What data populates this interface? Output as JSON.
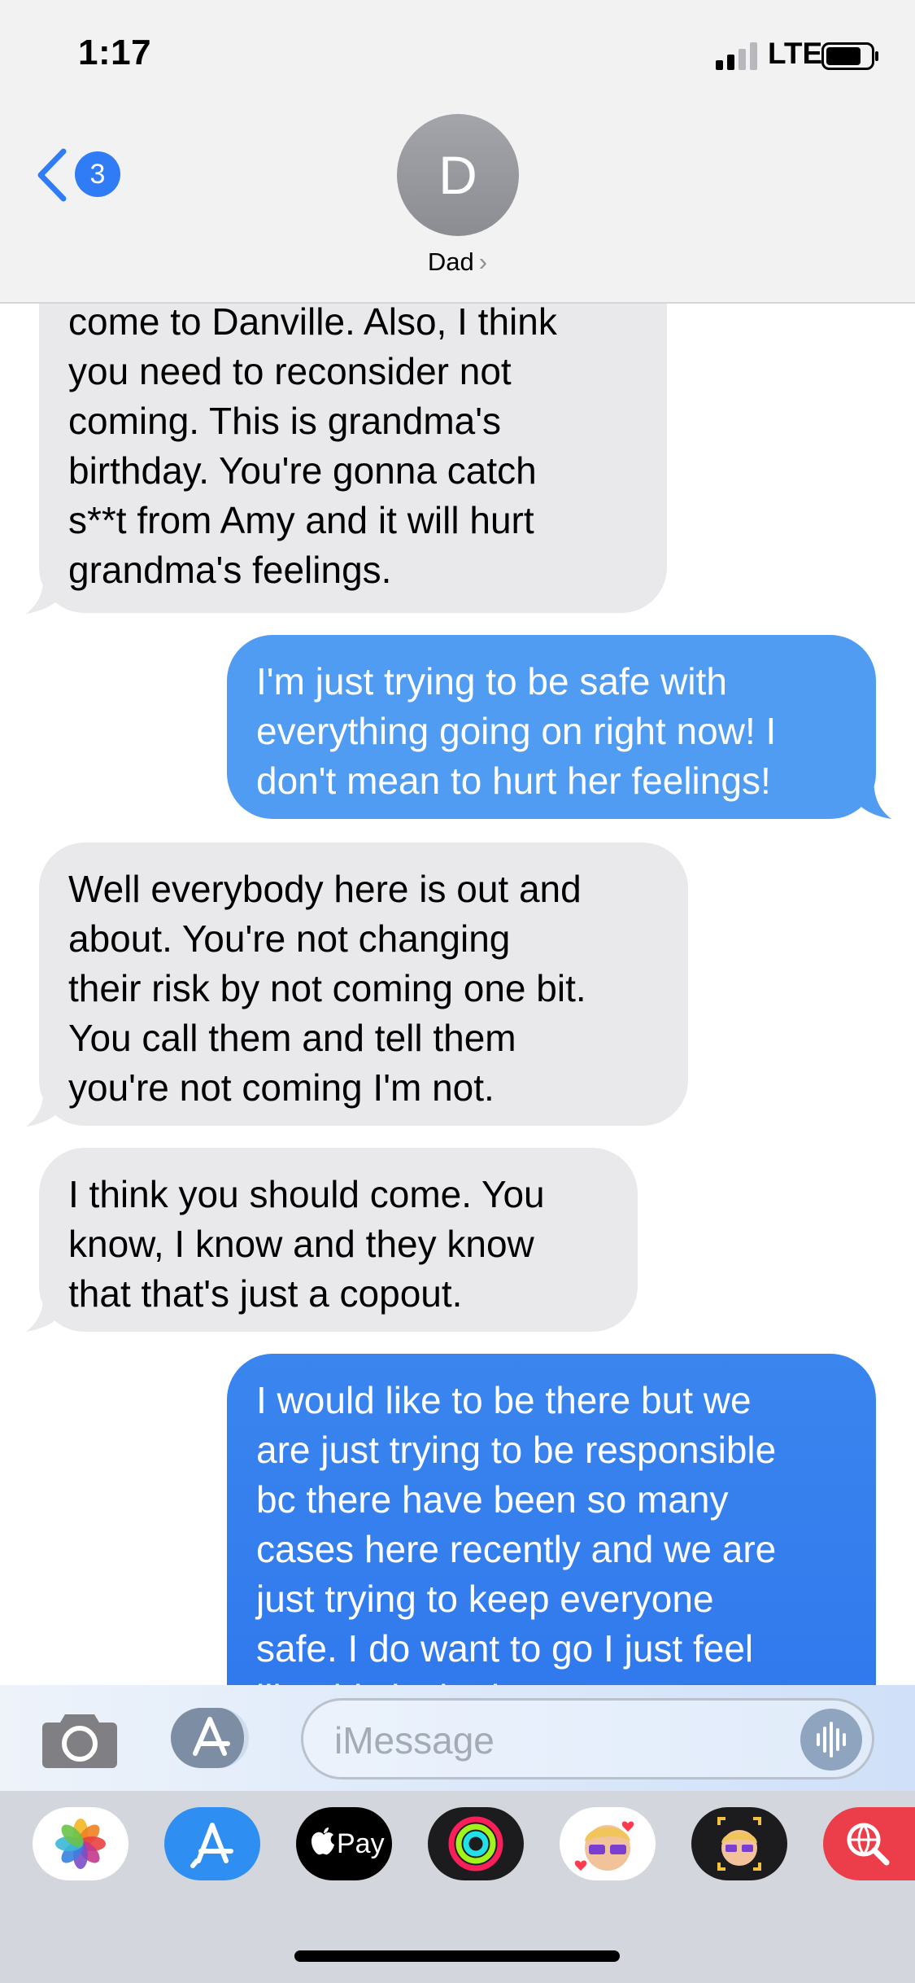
{
  "status_bar": {
    "time": "1:17",
    "network": "LTE"
  },
  "header": {
    "back_badge": "3",
    "avatar_initial": "D",
    "contact_name": "Dad",
    "name_chevron": "›"
  },
  "messages": [
    {
      "sender": "other",
      "text": "come to Danville. Also, I think\nyou need to reconsider not\ncoming. This is grandma's\nbirthday. You're gonna catch\ns**t from Amy and it will hurt\ngrandma's feelings."
    },
    {
      "sender": "me",
      "text": "I'm just trying to be safe with\neverything going on right now! I\ndon't mean to hurt her feelings!"
    },
    {
      "sender": "other",
      "text": "Well everybody here is out and\nabout. You're not changing\ntheir risk by not coming one bit.\nYou call them and tell them\nyou're not coming I'm not."
    },
    {
      "sender": "other",
      "text": "I think you should come. You\nknow, I know and they know\nthat that's just a copout."
    },
    {
      "sender": "me",
      "text": "I would like to be there but we\nare just trying to be responsible\nbc there have been so many\ncases here recently and we are\njust trying to keep everyone\nsafe. I do want to go I just feel\nlike this is the best"
    }
  ],
  "input": {
    "placeholder": "iMessage"
  },
  "app_drawer": {
    "apps": [
      "photos-icon",
      "app-store-icon",
      "apple-pay-icon",
      "activity-icon",
      "memoji-icon",
      "animoji-icon",
      "web-search-icon"
    ],
    "apple_pay_label": "Pay"
  },
  "colors": {
    "incoming_bubble": "#e9e9eb",
    "outgoing_bubble": "#4f9cf2",
    "accent": "#2f7cf6"
  }
}
